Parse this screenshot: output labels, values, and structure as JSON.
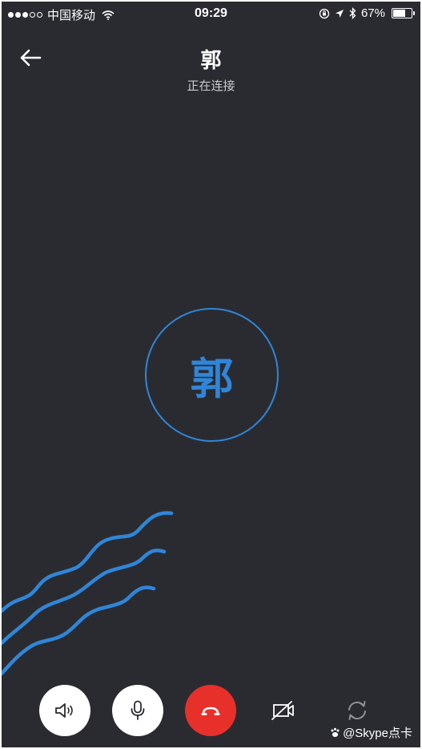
{
  "status_bar": {
    "signal_dots_filled": 3,
    "signal_dots_total": 5,
    "carrier": "中国移动",
    "time": "09:29",
    "battery_percent_label": "67%",
    "battery_level": 0.67
  },
  "call": {
    "contact_name": "郭",
    "status": "正在连接",
    "avatar_initial": "郭"
  },
  "controls": {
    "speaker_icon": "speaker-icon",
    "mute_icon": "microphone-icon",
    "end_call_icon": "hang-up-icon",
    "video_icon": "video-off-icon",
    "switch_camera_icon": "switch-camera-icon"
  },
  "watermark": {
    "text": "@Skype点卡"
  },
  "colors": {
    "background": "#2a2b31",
    "accent": "#2f86d8",
    "end_call": "#e8302b"
  }
}
